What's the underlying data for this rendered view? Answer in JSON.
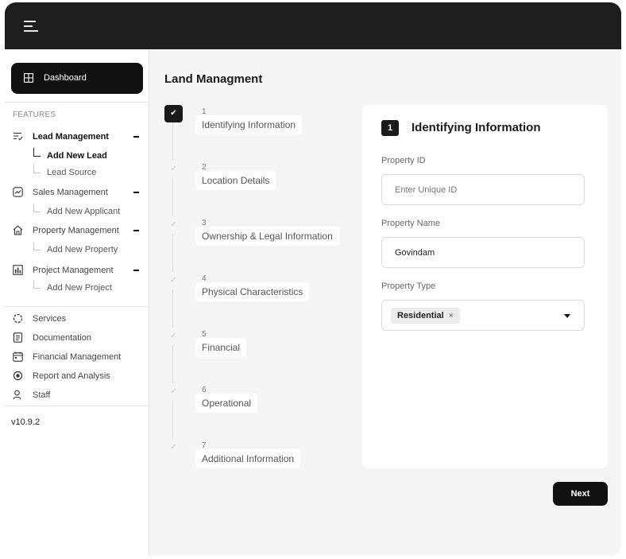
{
  "sidebar": {
    "dashboard_label": "Dashboard",
    "features_heading": "FEATURES",
    "groups": [
      {
        "label": "Lead Management",
        "icon": "list-check-icon",
        "items": [
          "Add New Lead",
          "Lead Source"
        ]
      },
      {
        "label": "Sales Management",
        "icon": "trend-chart-icon",
        "items": [
          "Add New Applicant"
        ]
      },
      {
        "label": "Property Management",
        "icon": "home-icon",
        "items": [
          "Add New Property"
        ]
      },
      {
        "label": "Project Management",
        "icon": "bar-chart-icon",
        "items": [
          "Add New Project"
        ]
      }
    ],
    "links": [
      {
        "label": "Services",
        "icon": "services-icon"
      },
      {
        "label": "Documentation",
        "icon": "document-icon"
      },
      {
        "label": "Financial Management",
        "icon": "calendar-icon"
      },
      {
        "label": "Report and Analysis",
        "icon": "target-icon"
      },
      {
        "label": "Staff",
        "icon": "user-icon"
      }
    ],
    "version": "v10.9.2"
  },
  "main": {
    "title": "Land Managment",
    "steps": [
      {
        "number": "1",
        "label": "Identifying Information",
        "active": true
      },
      {
        "number": "2",
        "label": "Location Details"
      },
      {
        "number": "3",
        "label": "Ownership & Legal Information"
      },
      {
        "number": "4",
        "label": "Physical Characteristics"
      },
      {
        "number": "5",
        "label": "Financial"
      },
      {
        "number": "6",
        "label": "Operational"
      },
      {
        "number": "7",
        "label": "Additional Information"
      }
    ],
    "panel": {
      "number": "1",
      "title": "Identifying Information",
      "property_id_label": "Property ID",
      "property_id_placeholder": "Enter Unique ID",
      "property_name_label": "Property Name",
      "property_name_value": "Govindam",
      "property_type_label": "Property Type",
      "property_type_value": "Residential",
      "chip_remove": "×"
    },
    "next_label": "Next"
  },
  "colors": {
    "topbar": "#1e1e1e",
    "accent": "#111111",
    "background": "#f5f5f5"
  }
}
